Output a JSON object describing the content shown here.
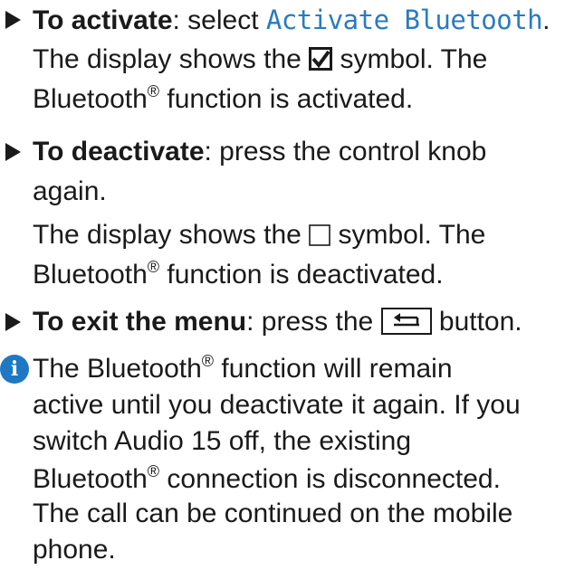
{
  "steps": [
    {
      "lead": "To activate",
      "line1_pre": ": select ",
      "display_text": "Activate Bluetooth",
      "line1_post": ".",
      "line2_pre": "The display shows the ",
      "symbol": "checkbox-checked-icon",
      "line2_post": " symbol. The",
      "line3_pre": "Bluetooth",
      "reg": "®",
      "line3_post": " function is activated."
    },
    {
      "lead": "To deactivate",
      "line1_post": ": press the control knob",
      "line2": "again.",
      "line3_pre": "The display shows the ",
      "symbol": "checkbox-empty-icon",
      "line3_post": " symbol. The",
      "line4_pre": "Bluetooth",
      "reg": "®",
      "line4_post": " function is deactivated."
    },
    {
      "lead": "To exit the menu",
      "line1_pre": ": press the ",
      "symbol": "back-button-icon",
      "line1_post": " button."
    }
  ],
  "note": {
    "icon": "info-icon",
    "icon_glyph": "i",
    "l1_pre": " The Bluetooth",
    "reg": "®",
    "l1_post": " function will remain",
    "l2": "active until you deactivate it again. If you",
    "l3": "switch Audio 15 off, the existing",
    "l4_pre": "Bluetooth",
    "l4_post": " connection is disconnected.",
    "l5": "The call can be continued on the mobile",
    "l6": "phone."
  },
  "colors": {
    "display_text": "#2a7bc0",
    "info_icon": "#1f78c4"
  }
}
